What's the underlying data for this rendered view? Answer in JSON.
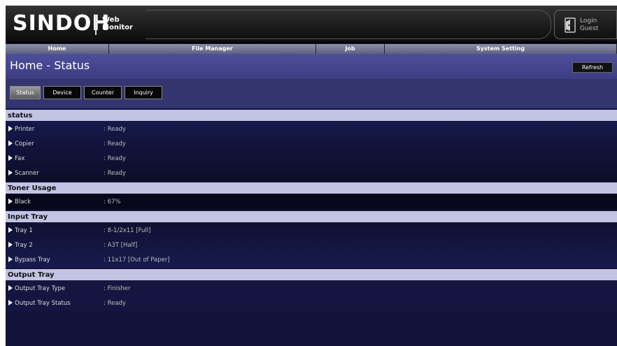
{
  "header": {
    "logo": "SINDOH",
    "logo_sub_line1": "Web",
    "logo_sub_line2": "Monitor",
    "login_label": "Login",
    "login_user": "Guest"
  },
  "nav": {
    "items": [
      {
        "label": "Home"
      },
      {
        "label": "File Manager"
      },
      {
        "label": "Job"
      },
      {
        "label": "System Setting"
      }
    ]
  },
  "page": {
    "title": "Home - Status",
    "refresh_label": "Refresh"
  },
  "tabs": [
    {
      "label": "Status",
      "active": true
    },
    {
      "label": "Device",
      "active": false
    },
    {
      "label": "Counter",
      "active": false
    },
    {
      "label": "Inquiry",
      "active": false
    }
  ],
  "sections": {
    "status": {
      "title": "status",
      "rows": [
        {
          "label": "Printer",
          "value": ": Ready"
        },
        {
          "label": "Copier",
          "value": ": Ready"
        },
        {
          "label": "Fax",
          "value": ": Ready"
        },
        {
          "label": "Scanner",
          "value": ": Ready"
        }
      ]
    },
    "toner": {
      "title": "Toner Usage",
      "rows": [
        {
          "label": "Black",
          "value": ": 67%"
        }
      ]
    },
    "input_tray": {
      "title": "Input Tray",
      "rows": [
        {
          "label": "Tray 1",
          "value": ": 8-1/2x11 [Full]"
        },
        {
          "label": "Tray 2",
          "value": ": A3T [Half]"
        },
        {
          "label": "Bypass Tray",
          "value": ": 11x17 [Out of Paper]"
        }
      ]
    },
    "output_tray": {
      "title": "Output Tray",
      "rows": [
        {
          "label": "Output Tray Type",
          "value": ": Finisher"
        },
        {
          "label": "Output Tray Status",
          "value": ": Ready"
        }
      ]
    }
  },
  "icons": {
    "login": "login-door-icon",
    "row_marker": "arrow-right-icon"
  }
}
